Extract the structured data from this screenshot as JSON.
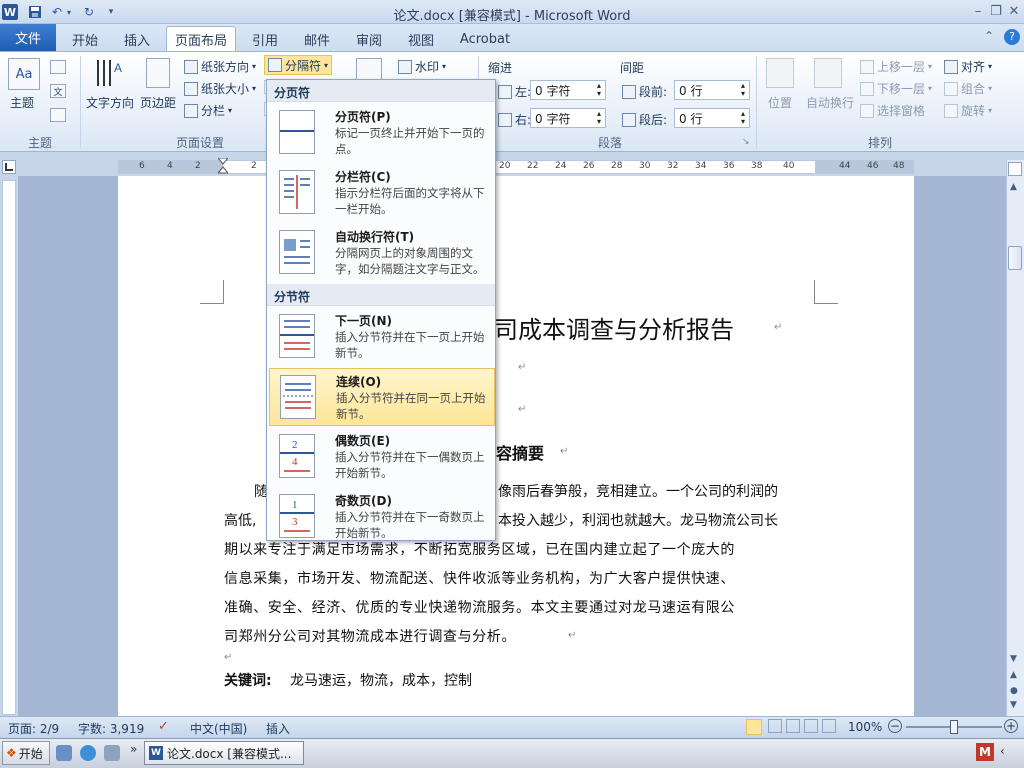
{
  "title_bar": {
    "title": "论文.docx [兼容模式] - Microsoft Word",
    "app_icon_letter": "W"
  },
  "ribbon_tabs": {
    "file": "文件",
    "items": [
      "开始",
      "插入",
      "页面布局",
      "引用",
      "邮件",
      "审阅",
      "视图",
      "Acrobat"
    ],
    "active": "页面布局"
  },
  "ribbon": {
    "theme_group": {
      "label": "主题",
      "themes_button": "主题"
    },
    "page_setup_group": {
      "label": "页面设置",
      "text_direction": "文字方向",
      "margins": "页边距",
      "orientation": "纸张方向",
      "size": "纸张大小",
      "columns": "分栏",
      "breaks": "分隔符"
    },
    "page_bg": {
      "watermark": "水印"
    },
    "paragraph_group": {
      "label": "段落",
      "indent_title": "缩进",
      "indent_left_label": "左:",
      "indent_left_value": "0 字符",
      "indent_right_label": "右:",
      "indent_right_value": "0 字符",
      "spacing_title": "间距",
      "spacing_before_label": "段前:",
      "spacing_before_value": "0 行",
      "spacing_after_label": "段后:",
      "spacing_after_value": "0 行"
    },
    "arrange_group": {
      "label": "排列",
      "position": "位置",
      "wrap_text": "自动换行",
      "bring_forward": "上移一层",
      "send_backward": "下移一层",
      "selection_pane": "选择窗格",
      "align": "对齐",
      "group": "组合",
      "rotate": "旋转"
    }
  },
  "ruler": {
    "labels": [
      "6",
      "4",
      "2",
      "2",
      "20",
      "22",
      "24",
      "26",
      "28",
      "30",
      "32",
      "34",
      "36",
      "38",
      "40",
      "44",
      "46",
      "48"
    ]
  },
  "breaks_menu": {
    "page_breaks_header": "分页符",
    "section_breaks_header": "分节符",
    "items": [
      {
        "title": "分页符(P)",
        "desc": "标记一页终止并开始下一页的点。"
      },
      {
        "title": "分栏符(C)",
        "desc": "指示分栏符后面的文字将从下一栏开始。"
      },
      {
        "title": "自动换行符(T)",
        "desc": "分隔网页上的对象周围的文字，如分隔题注文字与正文。"
      },
      {
        "title": "下一页(N)",
        "desc": "插入分节符并在下一页上开始新节。"
      },
      {
        "title": "连续(O)",
        "desc": "插入分节符并在同一页上开始新节。"
      },
      {
        "title": "偶数页(E)",
        "desc": "插入分节符并在下一偶数页上开始新节。"
      },
      {
        "title": "奇数页(D)",
        "desc": "插入分节符并在下一奇数页上开始新节。"
      }
    ],
    "highlighted_index": 4
  },
  "document": {
    "title_visible": "司成本调查与分析报告",
    "abstract_heading_visible": "容摘要",
    "para_line1_left": "随",
    "para_line1_right": "像雨后春笋般，竞相建立。一个公司的利润的",
    "para_line2_left": "高低,",
    "para_line2_right": "本投入越少，利润也就越大。龙马物流公司长",
    "para_line3": "期以来专注于满足市场需求，不断拓宽服务区域，已在国内建立起了一个庞大的",
    "para_line4": "信息采集，市场开发、物流配送、快件收派等业务机构，为广大客户提供快速、",
    "para_line5": "准确、安全、经济、优质的专业快递物流服务。本文主要通过对龙马速运有限公",
    "para_line6": "司郑州分公司对其物流成本进行调查与分析。",
    "keywords_label": "关键词:",
    "keywords_value": "龙马速运，物流，成本，控制"
  },
  "status_bar": {
    "page": "页面: 2/9",
    "words": "字数: 3,919",
    "language": "中文(中国)",
    "mode": "插入",
    "zoom": "100%"
  },
  "taskbar": {
    "start": "开始",
    "task_item": "论文.docx [兼容模式..."
  }
}
